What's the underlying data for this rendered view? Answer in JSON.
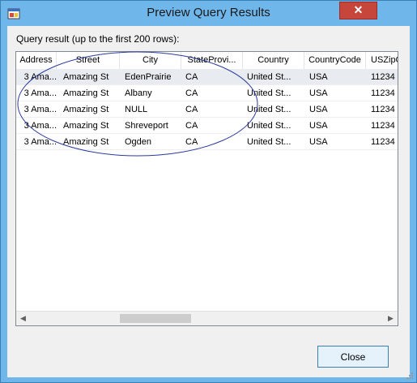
{
  "window": {
    "title": "Preview Query Results",
    "close_glyph": "✕"
  },
  "caption": "Query result (up to the first 200 rows):",
  "grid": {
    "columns": [
      "Address",
      "Street",
      "City",
      "StateProvi...",
      "Country",
      "CountryCode",
      "USZipC"
    ],
    "rows": [
      [
        "3 Ama...",
        "Amazing St",
        "EdenPrairie",
        "CA",
        "United St...",
        "USA",
        "11234"
      ],
      [
        "3 Ama...",
        "Amazing St",
        "Albany",
        "CA",
        "United St...",
        "USA",
        "11234"
      ],
      [
        "3 Ama...",
        "Amazing St",
        "NULL",
        "CA",
        "United St...",
        "USA",
        "11234"
      ],
      [
        "3 Ama...",
        "Amazing St",
        "Shreveport",
        "CA",
        "United St...",
        "USA",
        "11234"
      ],
      [
        "3 Ama...",
        "Amazing St",
        "Ogden",
        "CA",
        "United St...",
        "USA",
        "11234"
      ]
    ],
    "scroll_left_glyph": "◀",
    "scroll_right_glyph": "▶"
  },
  "buttons": {
    "close": "Close"
  },
  "colors": {
    "frame": "#6fb6ea",
    "close_red": "#c7463c",
    "annotation": "#2b3a9e"
  }
}
